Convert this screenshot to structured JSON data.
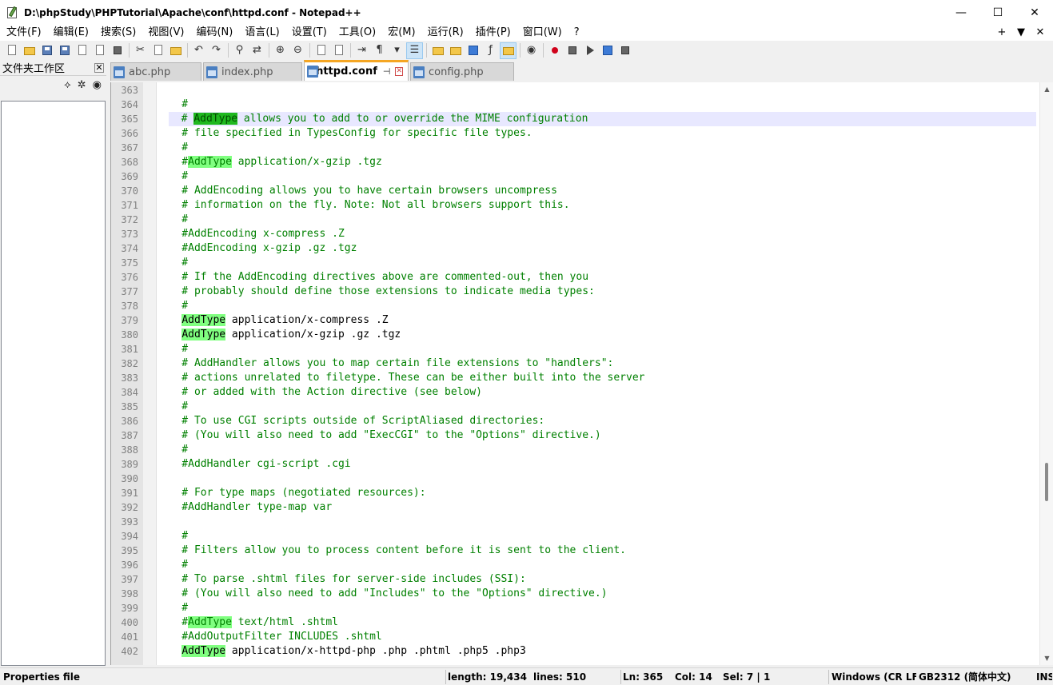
{
  "window": {
    "title": "D:\\phpStudy\\PHPTutorial\\Apache\\conf\\httpd.conf - Notepad++",
    "minimize": "—",
    "maximize": "☐",
    "close": "✕"
  },
  "menu": {
    "items": [
      "文件(F)",
      "编辑(E)",
      "搜索(S)",
      "视图(V)",
      "编码(N)",
      "语言(L)",
      "设置(T)",
      "工具(O)",
      "宏(M)",
      "运行(R)",
      "插件(P)",
      "窗口(W)",
      "?"
    ],
    "right": [
      "+",
      "▼",
      "✕"
    ]
  },
  "left_panel": {
    "title": "文件夹工作区",
    "close": "✕",
    "tools": [
      "⟡",
      "✲",
      "◉"
    ]
  },
  "tabs": [
    {
      "label": "abc.php",
      "active": false
    },
    {
      "label": "index.php",
      "active": false
    },
    {
      "label": "httpd.conf",
      "active": true,
      "pin": "⊣",
      "close": "✕"
    },
    {
      "label": "config.php",
      "active": false
    }
  ],
  "editor": {
    "current_line": 365,
    "lines": [
      {
        "n": "363",
        "text": ""
      },
      {
        "n": "364",
        "text": "    #"
      },
      {
        "n": "365",
        "text": "    # AddType allows you to add to or override the MIME configuration"
      },
      {
        "n": "366",
        "text": "    # file specified in TypesConfig for specific file types."
      },
      {
        "n": "367",
        "text": "    #"
      },
      {
        "n": "368",
        "text": "    #AddType application/x-gzip .tgz"
      },
      {
        "n": "369",
        "text": "    #"
      },
      {
        "n": "370",
        "text": "    # AddEncoding allows you to have certain browsers uncompress"
      },
      {
        "n": "371",
        "text": "    # information on the fly. Note: Not all browsers support this."
      },
      {
        "n": "372",
        "text": "    #"
      },
      {
        "n": "373",
        "text": "    #AddEncoding x-compress .Z"
      },
      {
        "n": "374",
        "text": "    #AddEncoding x-gzip .gz .tgz"
      },
      {
        "n": "375",
        "text": "    #"
      },
      {
        "n": "376",
        "text": "    # If the AddEncoding directives above are commented-out, then you"
      },
      {
        "n": "377",
        "text": "    # probably should define those extensions to indicate media types:"
      },
      {
        "n": "378",
        "text": "    #"
      },
      {
        "n": "379",
        "text": "    AddType application/x-compress .Z"
      },
      {
        "n": "380",
        "text": "    AddType application/x-gzip .gz .tgz"
      },
      {
        "n": "381",
        "text": "    #"
      },
      {
        "n": "382",
        "text": "    # AddHandler allows you to map certain file extensions to \"handlers\":"
      },
      {
        "n": "383",
        "text": "    # actions unrelated to filetype. These can be either built into the server"
      },
      {
        "n": "384",
        "text": "    # or added with the Action directive (see below)"
      },
      {
        "n": "385",
        "text": "    #"
      },
      {
        "n": "386",
        "text": "    # To use CGI scripts outside of ScriptAliased directories:"
      },
      {
        "n": "387",
        "text": "    # (You will also need to add \"ExecCGI\" to the \"Options\" directive.)"
      },
      {
        "n": "388",
        "text": "    #"
      },
      {
        "n": "389",
        "text": "    #AddHandler cgi-script .cgi"
      },
      {
        "n": "390",
        "text": ""
      },
      {
        "n": "391",
        "text": "    # For type maps (negotiated resources):"
      },
      {
        "n": "392",
        "text": "    #AddHandler type-map var"
      },
      {
        "n": "393",
        "text": ""
      },
      {
        "n": "394",
        "text": "    #"
      },
      {
        "n": "395",
        "text": "    # Filters allow you to process content before it is sent to the client."
      },
      {
        "n": "396",
        "text": "    #"
      },
      {
        "n": "397",
        "text": "    # To parse .shtml files for server-side includes (SSI):"
      },
      {
        "n": "398",
        "text": "    # (You will also need to add \"Includes\" to the \"Options\" directive.)"
      },
      {
        "n": "399",
        "text": "    #"
      },
      {
        "n": "400",
        "text": "    #AddType text/html .shtml"
      },
      {
        "n": "401",
        "text": "    #AddOutputFilter INCLUDES .shtml"
      },
      {
        "n": "402",
        "text": "    AddType application/x-httpd-php .php .phtml .php5 .php3"
      }
    ]
  },
  "status": {
    "file_type": "Properties file",
    "length": "length: 19,434",
    "lines": "lines: 510",
    "ln": "Ln: 365",
    "col": "Col: 14",
    "sel": "Sel: 7 | 1",
    "eol": "Windows (CR LF",
    "encoding": "GB2312 (简体中文)",
    "mode": "INS"
  },
  "colors": {
    "comment": "#008000",
    "highlight": "#80ff80",
    "current_line": "#e8e8ff",
    "active_tab_accent": "#f5a623"
  }
}
